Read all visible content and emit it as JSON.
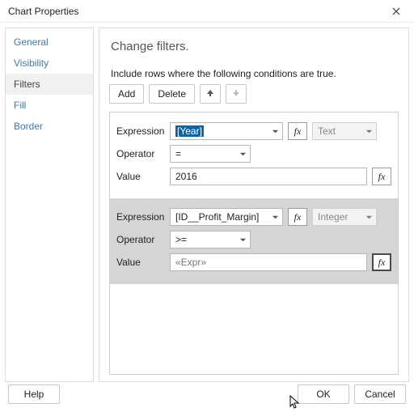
{
  "title": "Chart Properties",
  "sidebar": {
    "items": [
      {
        "label": "General"
      },
      {
        "label": "Visibility"
      },
      {
        "label": "Filters"
      },
      {
        "label": "Fill"
      },
      {
        "label": "Border"
      }
    ]
  },
  "main": {
    "heading": "Change filters.",
    "instruction": "Include rows where the following conditions are true.",
    "toolbar": {
      "add": "Add",
      "delete": "Delete"
    },
    "labels": {
      "expression": "Expression",
      "operator": "Operator",
      "value": "Value"
    },
    "filters": [
      {
        "expression": "[Year]",
        "operator": "=",
        "value": "2016",
        "type": "Text",
        "exprHighlighted": true
      },
      {
        "expression": "[ID__Profit_Margin]",
        "operator": ">=",
        "value": "«Expr»",
        "type": "Integer",
        "fxActive": true
      }
    ]
  },
  "footer": {
    "help": "Help",
    "ok": "OK",
    "cancel": "Cancel"
  },
  "fx": "fx"
}
